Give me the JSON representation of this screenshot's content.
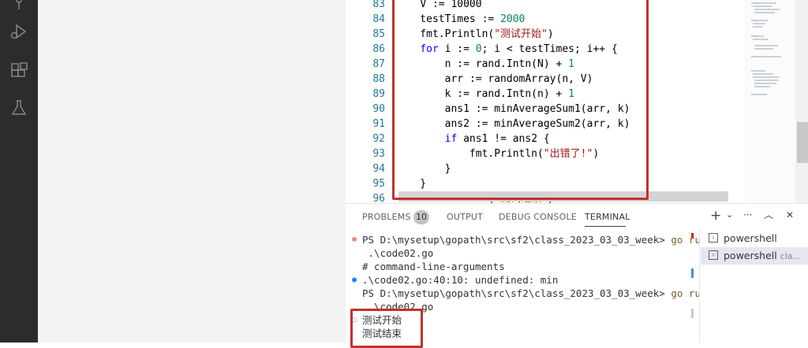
{
  "editor": {
    "lines": [
      {
        "n": "83",
        "parts": [
          {
            "t": "    ",
            "c": ""
          },
          {
            "t": "V := 10000",
            "c": ""
          }
        ]
      },
      {
        "n": "84",
        "parts": [
          {
            "t": "    testTimes := ",
            "c": ""
          },
          {
            "t": "2000",
            "c": "num"
          }
        ]
      },
      {
        "n": "85",
        "parts": [
          {
            "t": "    fmt.Println(",
            "c": ""
          },
          {
            "t": "\"测试开始\"",
            "c": "str"
          },
          {
            "t": ")",
            "c": ""
          }
        ]
      },
      {
        "n": "86",
        "parts": [
          {
            "t": "    ",
            "c": ""
          },
          {
            "t": "for",
            "c": "kw"
          },
          {
            "t": " i := ",
            "c": ""
          },
          {
            "t": "0",
            "c": "num"
          },
          {
            "t": "; i < testTimes; i++ {",
            "c": ""
          }
        ]
      },
      {
        "n": "87",
        "parts": [
          {
            "t": "        n := rand.Intn(N) + ",
            "c": ""
          },
          {
            "t": "1",
            "c": "num"
          }
        ]
      },
      {
        "n": "88",
        "parts": [
          {
            "t": "        arr := randomArray(n, V)",
            "c": ""
          }
        ]
      },
      {
        "n": "89",
        "parts": [
          {
            "t": "        k := rand.Intn(n) + ",
            "c": ""
          },
          {
            "t": "1",
            "c": "num"
          }
        ]
      },
      {
        "n": "90",
        "parts": [
          {
            "t": "        ans1 := minAverageSum1(arr, k)",
            "c": ""
          }
        ]
      },
      {
        "n": "91",
        "parts": [
          {
            "t": "        ans2 := minAverageSum2(arr, k)",
            "c": ""
          }
        ]
      },
      {
        "n": "92",
        "parts": [
          {
            "t": "        ",
            "c": ""
          },
          {
            "t": "if",
            "c": "kw"
          },
          {
            "t": " ans1 != ans2 {",
            "c": ""
          }
        ]
      },
      {
        "n": "93",
        "parts": [
          {
            "t": "            fmt.Println(",
            "c": ""
          },
          {
            "t": "\"出错了!\"",
            "c": "str"
          },
          {
            "t": ")",
            "c": ""
          }
        ]
      },
      {
        "n": "94",
        "parts": [
          {
            "t": "        }",
            "c": ""
          }
        ]
      },
      {
        "n": "95",
        "parts": [
          {
            "t": "    }",
            "c": ""
          }
        ]
      },
      {
        "n": "96",
        "parts": [
          {
            "t": "    fmt.Println(",
            "c": ""
          },
          {
            "t": "\"测试结束\"",
            "c": "str"
          },
          {
            "t": ")",
            "c": ""
          }
        ]
      }
    ]
  },
  "panel": {
    "tabs": {
      "problems": "PROBLEMS",
      "output": "OUTPUT",
      "debug": "DEBUG CONSOLE",
      "terminal": "TERMINAL"
    },
    "problems_count": "10",
    "toolbar": {
      "add": "+",
      "dropdown": "⌄",
      "more": "···",
      "maximize": "︿",
      "close": "✕"
    }
  },
  "terminal": {
    "lines": [
      {
        "prefix": "PS D:\\mysetup\\gopath\\src\\sf2\\class_2023_03_03_week> ",
        "cmd": "go run"
      },
      {
        "prefix": " .\\code02.go",
        "cmd": ""
      },
      {
        "prefix": "# command-line-arguments",
        "cmd": ""
      },
      {
        "prefix": ".\\code02.go:40:10: undefined: min",
        "cmd": ""
      },
      {
        "prefix": "PS D:\\mysetup\\gopath\\src\\sf2\\class_2023_03_03_week> ",
        "cmd": "go run"
      },
      {
        "prefix": " .\\code02.go",
        "cmd": ""
      },
      {
        "prefix": "测试开始",
        "cmd": ""
      },
      {
        "prefix": "测试结束",
        "cmd": ""
      }
    ]
  },
  "shells": [
    {
      "label": "powershell",
      "sub": ""
    },
    {
      "label": "powershell",
      "sub": "cla..."
    }
  ],
  "colors": {
    "accent_red": "#c4302b",
    "activity_bar": "#2c2c2c"
  }
}
